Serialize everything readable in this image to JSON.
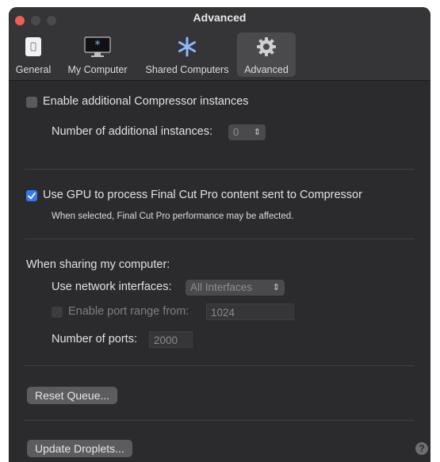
{
  "window": {
    "title": "Advanced"
  },
  "tabs": [
    {
      "label": "General",
      "icon": "general-icon"
    },
    {
      "label": "My Computer",
      "icon": "computer-icon"
    },
    {
      "label": "Shared Computers",
      "icon": "shared-computers-icon"
    },
    {
      "label": "Advanced",
      "icon": "gear-icon",
      "active": true
    }
  ],
  "instances": {
    "enable_label": "Enable additional Compressor instances",
    "enabled": false,
    "count_label": "Number of additional instances:",
    "count_value": "0"
  },
  "gpu": {
    "label": "Use GPU to process Final Cut Pro content sent to Compressor",
    "enabled": true,
    "note": "When selected, Final Cut Pro performance may be affected."
  },
  "sharing": {
    "heading": "When sharing my computer:",
    "network_label": "Use network interfaces:",
    "network_value": "All Interfaces",
    "port_range_label": "Enable port range from:",
    "port_range_enabled": false,
    "port_range_value": "1024",
    "ports_label": "Number of ports:",
    "ports_value": "2000"
  },
  "buttons": {
    "reset_queue": "Reset Queue...",
    "update_droplets": "Update Droplets..."
  },
  "help": {
    "glyph": "?"
  },
  "colors": {
    "accent": "#3478f6",
    "close": "#ed5f57",
    "window_bg": "#2b2b2d"
  }
}
